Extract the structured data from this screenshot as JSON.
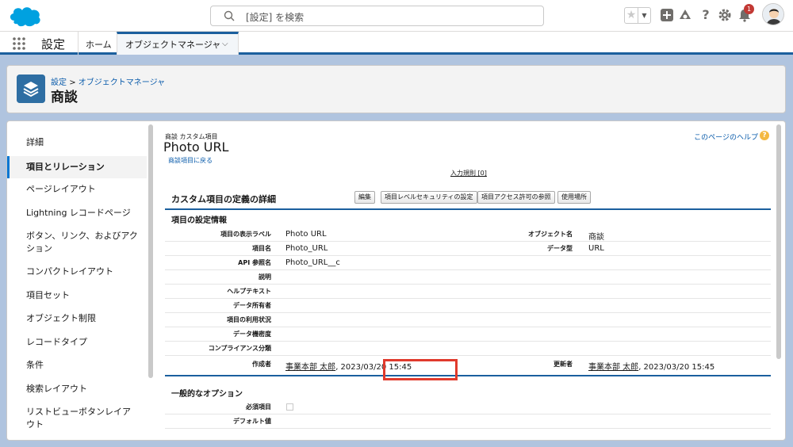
{
  "header": {
    "search_placeholder": "[設定] を検索",
    "notification_count": "1"
  },
  "nav": {
    "app_name": "設定",
    "home": "ホーム",
    "object_manager": "オブジェクトマネージャ"
  },
  "page_header": {
    "breadcrumb_settings": "設定",
    "breadcrumb_sep": ">",
    "breadcrumb_object_manager": "オブジェクトマネージャ",
    "title": "商談"
  },
  "sidebar": {
    "items": [
      {
        "label": "詳細"
      },
      {
        "label": "項目とリレーション"
      },
      {
        "label": "ページレイアウト"
      },
      {
        "label": "Lightning レコードページ"
      },
      {
        "label": "ボタン、リンク、およびアク"
      },
      {
        "label": "ション"
      },
      {
        "label": "コンパクトレイアウト"
      },
      {
        "label": "項目セット"
      },
      {
        "label": "オブジェクト制限"
      },
      {
        "label": "レコードタイプ"
      },
      {
        "label": "条件"
      },
      {
        "label": "検索レイアウト"
      },
      {
        "label": "リストビューボタンレイア"
      },
      {
        "label": "ウト"
      }
    ]
  },
  "content": {
    "subtitle": "商談 カスタム項目",
    "title": "Photo URL",
    "back_link": "商談項目に戻る",
    "help_link": "このページのヘルプ",
    "input_rules": "入力規則 [0]",
    "section_title": "カスタム項目の定義の詳細",
    "buttons": {
      "edit": "編集",
      "field_security": "項目レベルセキュリティの設定",
      "field_access": "項目アクセス許可の参照",
      "where_used": "使用場所"
    },
    "field_info_title": "項目の設定情報",
    "fields": {
      "label_label": "項目の表示ラベル",
      "label_value": "Photo URL",
      "name_label": "項目名",
      "name_value": "Photo_URL",
      "api_label": "API 参照名",
      "api_value": "Photo_URL__c",
      "desc_label": "説明",
      "helptext_label": "ヘルプテキスト",
      "owner_label": "データ所有者",
      "usage_label": "項目の利用状況",
      "sensitivity_label": "データ機密度",
      "compliance_label": "コンプライアンス分類",
      "created_label": "作成者",
      "created_user": "事業本部 太郎",
      "created_date": ", 2023/03/20 15:45",
      "object_label": "オブジェクト名",
      "object_value": "商談",
      "datatype_label": "データ型",
      "datatype_value": "URL",
      "modified_label": "更新者",
      "modified_user": "事業本部 太郎",
      "modified_date": ", 2023/03/20 15:45"
    },
    "general_title": "一般的なオプション",
    "general": {
      "required_label": "必須項目",
      "default_label": "デフォルト値"
    }
  },
  "colors": {
    "brand_blue": "#1b5f9e",
    "link": "#0b5cab",
    "highlight": "#e03a2c"
  }
}
